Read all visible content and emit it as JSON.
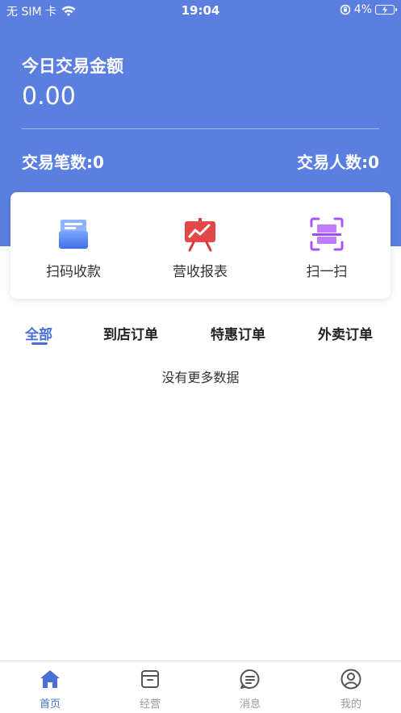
{
  "status_bar": {
    "carrier": "无 SIM 卡",
    "time": "19:04",
    "battery": "4%"
  },
  "summary": {
    "title": "今日交易金额",
    "amount": "0.00",
    "transactions": "交易笔数:0",
    "customers": "交易人数:0"
  },
  "quick_actions": [
    {
      "label": "扫码收款",
      "icon": "receipt-box-icon",
      "color": "#4f86f7"
    },
    {
      "label": "营收报表",
      "icon": "chart-board-icon",
      "color": "#e2484a"
    },
    {
      "label": "扫一扫",
      "icon": "scan-icon",
      "color": "#a855f7"
    }
  ],
  "tabs": [
    {
      "label": "全部",
      "active": true
    },
    {
      "label": "到店订单",
      "active": false
    },
    {
      "label": "特惠订单",
      "active": false
    },
    {
      "label": "外卖订单",
      "active": false
    }
  ],
  "empty_message": "没有更多数据",
  "bottom_nav": [
    {
      "label": "首页",
      "icon": "home-icon",
      "active": true
    },
    {
      "label": "经营",
      "icon": "box-icon",
      "active": false
    },
    {
      "label": "消息",
      "icon": "message-icon",
      "active": false
    },
    {
      "label": "我的",
      "icon": "user-icon",
      "active": false
    }
  ],
  "colors": {
    "primary": "#5b7fe0",
    "accent": "#4a6fd6"
  }
}
